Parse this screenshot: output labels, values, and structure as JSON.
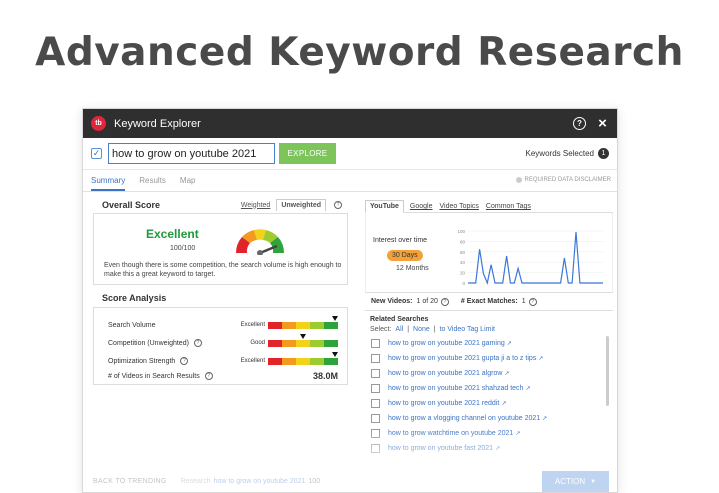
{
  "page_title": "Advanced Keyword Research",
  "window": {
    "logo_text": "tb",
    "title": "Keyword Explorer"
  },
  "search": {
    "checkbox_mark": "✓",
    "value": "how to grow on youtube 2021",
    "explore_label": "EXPLORE",
    "keywords_selected_label": "Keywords Selected",
    "keywords_selected_count": "1"
  },
  "tabs": [
    {
      "label": "Summary",
      "active": true
    },
    {
      "label": "Results",
      "active": false
    },
    {
      "label": "Map",
      "active": false
    }
  ],
  "disclaimer": "REQUIRED DATA DISCLAIMER",
  "overall_score": {
    "heading": "Overall Score",
    "weighted_label": "Weighted",
    "unweighted_label": "Unweighted",
    "rating": "Excellent",
    "score_text": "100/100",
    "score_value": 100,
    "description": "Even though there is some competition, the search volume is high enough to make this a great keyword to target."
  },
  "score_analysis": {
    "heading": "Score Analysis",
    "rows": [
      {
        "label": "Search Volume",
        "rating": "Excellent",
        "level": 1.0
      },
      {
        "label": "Competition (Unweighted)",
        "rating": "Good",
        "level": 0.5,
        "help": true
      },
      {
        "label": "Optimization Strength",
        "rating": "Excellent",
        "level": 1.0,
        "help": true
      },
      {
        "label": "# of Videos in Search Results",
        "value": "38.0M",
        "help": true
      }
    ],
    "bar_colors": [
      "#e0242a",
      "#e0242a",
      "#f39a1f",
      "#f39a1f",
      "#f2d21a",
      "#f2d21a",
      "#9dcc2e",
      "#9dcc2e",
      "#2ea33a",
      "#2ea33a"
    ]
  },
  "right_tabs": [
    {
      "label": "YouTube",
      "active": true
    },
    {
      "label": "Google",
      "active": false
    },
    {
      "label": "Video Topics",
      "active": false
    },
    {
      "label": "Common Tags",
      "active": false
    }
  ],
  "interest": {
    "label": "Interest over time",
    "range_30": "30 Days",
    "range_12": "12 Months"
  },
  "chart_data": {
    "type": "line",
    "y_ticks": [
      "100",
      "80",
      "60",
      "40",
      "20",
      "0"
    ],
    "ylim": [
      0,
      100
    ],
    "values": [
      0,
      0,
      0,
      65,
      18,
      0,
      35,
      0,
      0,
      0,
      52,
      0,
      0,
      28,
      0,
      0,
      0,
      0,
      0,
      0,
      0,
      0,
      0,
      0,
      0,
      48,
      0,
      0,
      98,
      0,
      0,
      0,
      0,
      0,
      0,
      0
    ],
    "color": "#3b78d8"
  },
  "stats": {
    "new_videos_label": "New Videos:",
    "new_videos_value": "1 of 20",
    "exact_matches_label": "# Exact Matches:",
    "exact_matches_value": "1"
  },
  "related": {
    "heading": "Related Searches",
    "select_label": "Select:",
    "all_label": "All",
    "none_label": "None",
    "to_tag_label": "to Video Tag Limit",
    "items": [
      "how to grow on youtube 2021 gaming",
      "how to grow on youtube 2021 gupta ji a to z tips",
      "how to grow on youtube 2021 algrow",
      "how to grow on youtube 2021 shahzad tech",
      "how to grow on youtube 2021 reddit",
      "how to grow a vlogging channel on youtube 2021",
      "how to grow watchtime on youtube 2021",
      "how to grow on youtube fast 2021"
    ]
  },
  "footer": {
    "back_label": "BACK TO TRENDING",
    "research_prefix": "Research",
    "research_link": "how to grow on youtube 2021",
    "research_count": "100",
    "action_label": "ACTION"
  }
}
